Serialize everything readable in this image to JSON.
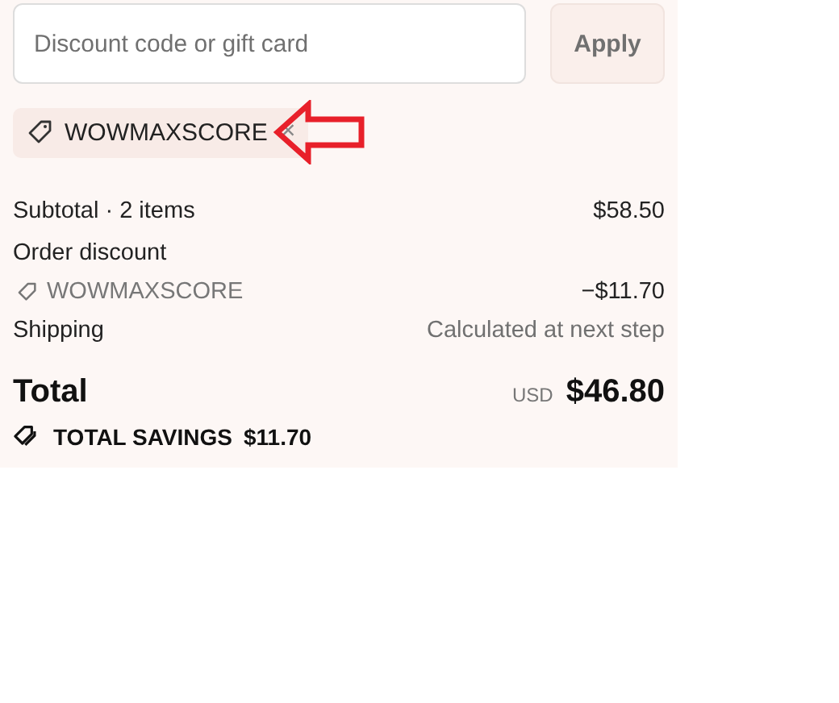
{
  "discount_field": {
    "placeholder": "Discount code or gift card"
  },
  "apply_button": {
    "label": "Apply",
    "disabled": true
  },
  "applied_code": {
    "code": "WOWMAXSCORE",
    "remove": "×"
  },
  "summary": {
    "rows": [
      {
        "kind": "line",
        "label": "Subtotal · 2 items",
        "value": "$58.50"
      },
      {
        "kind": "heading",
        "label": "Order discount"
      },
      {
        "kind": "code",
        "label": "WOWMAXSCORE",
        "value": "−$11.70"
      },
      {
        "kind": "muted",
        "label": "Shipping",
        "value": "Calculated at next step"
      }
    ]
  },
  "total": {
    "label": "Total",
    "currency": "USD",
    "amount": "$46.80"
  },
  "savings": {
    "label": "TOTAL SAVINGS",
    "amount": "$11.70"
  }
}
